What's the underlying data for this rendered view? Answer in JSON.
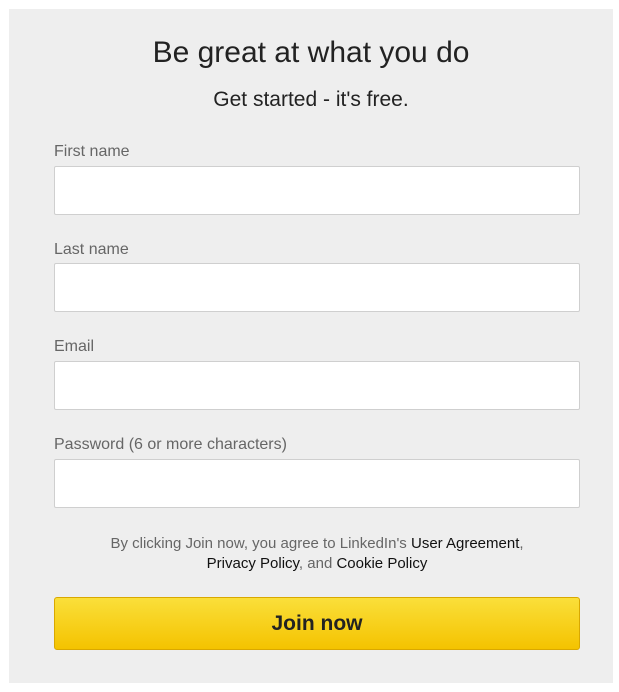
{
  "signup": {
    "headline": "Be great at what you do",
    "subheadline": "Get started - it's free.",
    "fields": [
      {
        "label": "First name",
        "value": "",
        "placeholder": ""
      },
      {
        "label": "Last name",
        "value": "",
        "placeholder": ""
      },
      {
        "label": "Email",
        "value": "",
        "placeholder": ""
      },
      {
        "label": "Password (6 or more characters)",
        "value": "",
        "placeholder": ""
      }
    ],
    "terms": {
      "prefix": "By clicking Join now, you agree to LinkedIn's ",
      "user_agreement": "User Agreement",
      "comma": ",",
      "privacy_policy": "Privacy Policy",
      "and": ", and ",
      "cookie_policy": "Cookie Policy"
    },
    "join_label": "Join now"
  },
  "colors": {
    "panel_bg": "#eeeeee",
    "button_top": "#fadf3a",
    "button_bottom": "#f4c300",
    "label_text": "#666666"
  }
}
